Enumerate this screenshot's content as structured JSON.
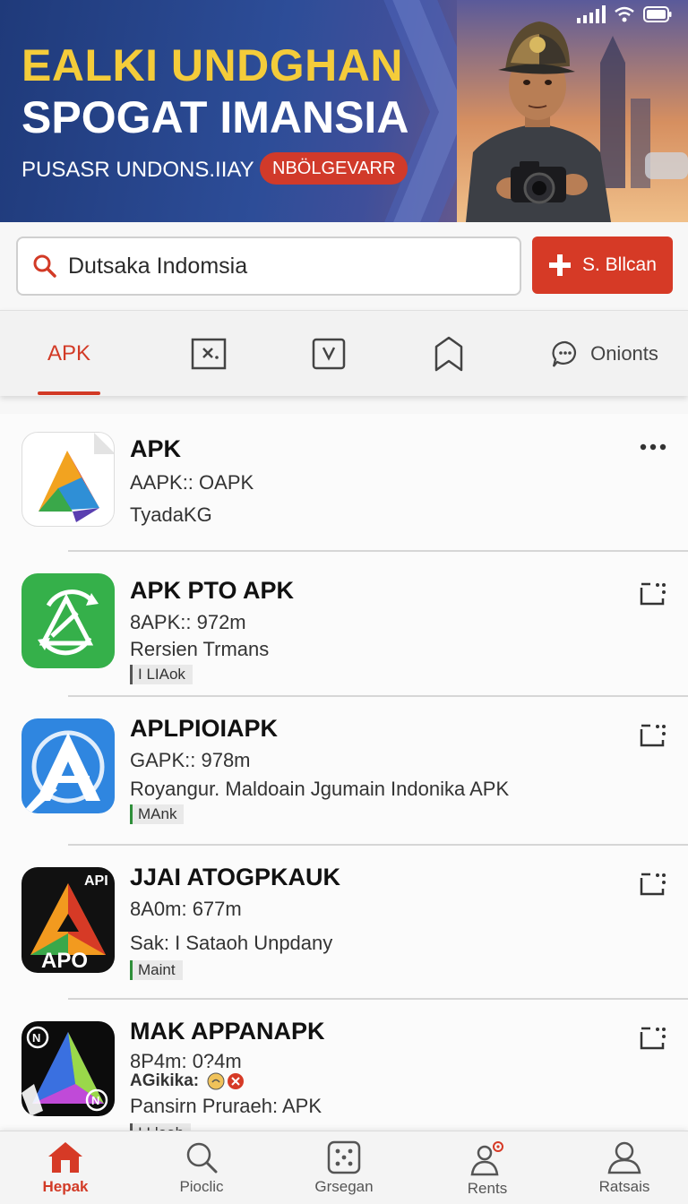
{
  "colors": {
    "accent": "#d63a26",
    "hero_title_yellow": "#f4cc3a",
    "hero_bg": "#2d4d98",
    "tag_green": "#2f8f3a"
  },
  "hero": {
    "title_line1": "EALKI UNDGHAN",
    "title_line2": "SPOGAT IMANSIA",
    "subtitle": "PUSASR UNDONS.IIAY",
    "badge": "NBÖLGEVARR"
  },
  "search": {
    "placeholder": "Dutsaka Indomsia",
    "icon": "search-icon"
  },
  "add_button": {
    "label": "S. Bllcan",
    "icon": "plus-icon"
  },
  "tabs": [
    {
      "label": "APK",
      "active": true
    },
    {
      "icon": "close-box-icon"
    },
    {
      "icon": "chevron-box-icon"
    },
    {
      "icon": "bookmark-icon"
    },
    {
      "label": "Onionts",
      "icon": "chat-bubble-icon"
    }
  ],
  "apps": [
    {
      "title": "APK",
      "meta": "AAPK:: OAPK",
      "desc": "TyadaKG",
      "tag": "",
      "action_icon": "more-icon"
    },
    {
      "title": "APK PTO APK",
      "meta": "8APK:: 972m",
      "desc": "Rersien Trmans",
      "tag": "I LIAok",
      "action_icon": "expand-icon"
    },
    {
      "title": "APLPIOIAPK",
      "meta": "GAPK:: 978m",
      "desc": "Royangur. Maldoain Jgumain Indonika APK",
      "tag": "MAnk",
      "action_icon": "expand-icon"
    },
    {
      "title": "JJAI ATOGPKAUK",
      "meta": "8A0m: 677m",
      "desc": "Sak: I Sataoh Unpdany",
      "tag": "Maint",
      "action_icon": "expand-icon"
    },
    {
      "title": "MAK APPANAPK",
      "meta": "8P4m: 0?4m",
      "meta2": "AGikika:",
      "desc": "Pansirn Pruraeh: APK",
      "tag": "I Lleah",
      "action_icon": "expand-icon"
    }
  ],
  "icon_labels": {
    "app4_top": "API",
    "app4_bottom": "APO",
    "app5_corner": "N"
  },
  "bottom_nav": [
    {
      "label": "Hepak",
      "icon": "home-icon",
      "active": true
    },
    {
      "label": "Pioclic",
      "icon": "search-icon"
    },
    {
      "label": "Grsegan",
      "icon": "dice-icon"
    },
    {
      "label": "Rents",
      "icon": "user-notify-icon"
    },
    {
      "label": "Ratsais",
      "icon": "profile-icon"
    }
  ]
}
